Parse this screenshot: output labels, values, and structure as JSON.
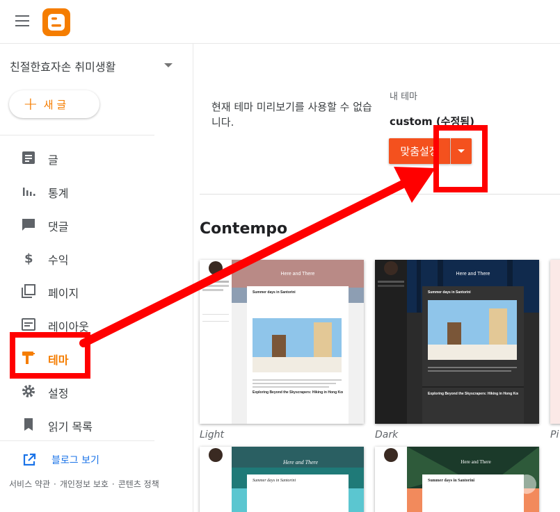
{
  "topbar": {
    "menu_icon": "hamburger-menu-icon",
    "logo_icon": "blogger-logo-icon"
  },
  "sidebar": {
    "blog_name": "친절한효자손 취미생활",
    "new_post_label": "새 글",
    "nav": [
      {
        "key": "posts",
        "label": "글",
        "icon": "posts-icon",
        "active": false
      },
      {
        "key": "stats",
        "label": "통계",
        "icon": "stats-icon",
        "active": false
      },
      {
        "key": "comments",
        "label": "댓글",
        "icon": "comments-icon",
        "active": false
      },
      {
        "key": "earnings",
        "label": "수익",
        "icon": "dollar-icon",
        "active": false
      },
      {
        "key": "pages",
        "label": "페이지",
        "icon": "pages-icon",
        "active": false
      },
      {
        "key": "layout",
        "label": "레이아웃",
        "icon": "layout-icon",
        "active": false
      },
      {
        "key": "theme",
        "label": "테마",
        "icon": "theme-roller-icon",
        "active": true
      },
      {
        "key": "settings",
        "label": "설정",
        "icon": "gear-icon",
        "active": false
      },
      {
        "key": "reading-list",
        "label": "읽기 목록",
        "icon": "bookmark-icon",
        "active": false
      }
    ],
    "view_blog_label": "블로그 보기",
    "footer": {
      "terms": "서비스 약관",
      "privacy": "개인정보 보호",
      "content_policy": "콘텐츠 정책"
    }
  },
  "main": {
    "preview_message": "현재 테마 미리보기를 사용할 수 없습니다.",
    "my_theme_label": "내 테마",
    "theme_name": "custom (수정됨)",
    "customize_label": "맞춤설정",
    "section_title": "Contempo",
    "themes": [
      {
        "caption": "Light",
        "hero_title": "Here and There",
        "post_title": "Summer days in Santorini",
        "post2_title": "Exploring Beyond the Skyscrapers: Hiking in Hong Kong"
      },
      {
        "caption": "Dark",
        "hero_title": "Here and There",
        "post_title": "Summer days in Santorini",
        "post2_title": "Exploring Beyond the Skyscrapers: Hiking in Hong Kong"
      },
      {
        "caption": "Pi"
      },
      {
        "hero_title": "Here and There",
        "post_title": "Summer days in Santorini"
      },
      {
        "hero_title": "Here and There",
        "post_title": "Summer days in Santorini"
      }
    ]
  },
  "colors": {
    "accent": "#f57d00",
    "customize_bg": "#f4511e",
    "annotation": "#ff0000",
    "link": "#1a73e8"
  }
}
